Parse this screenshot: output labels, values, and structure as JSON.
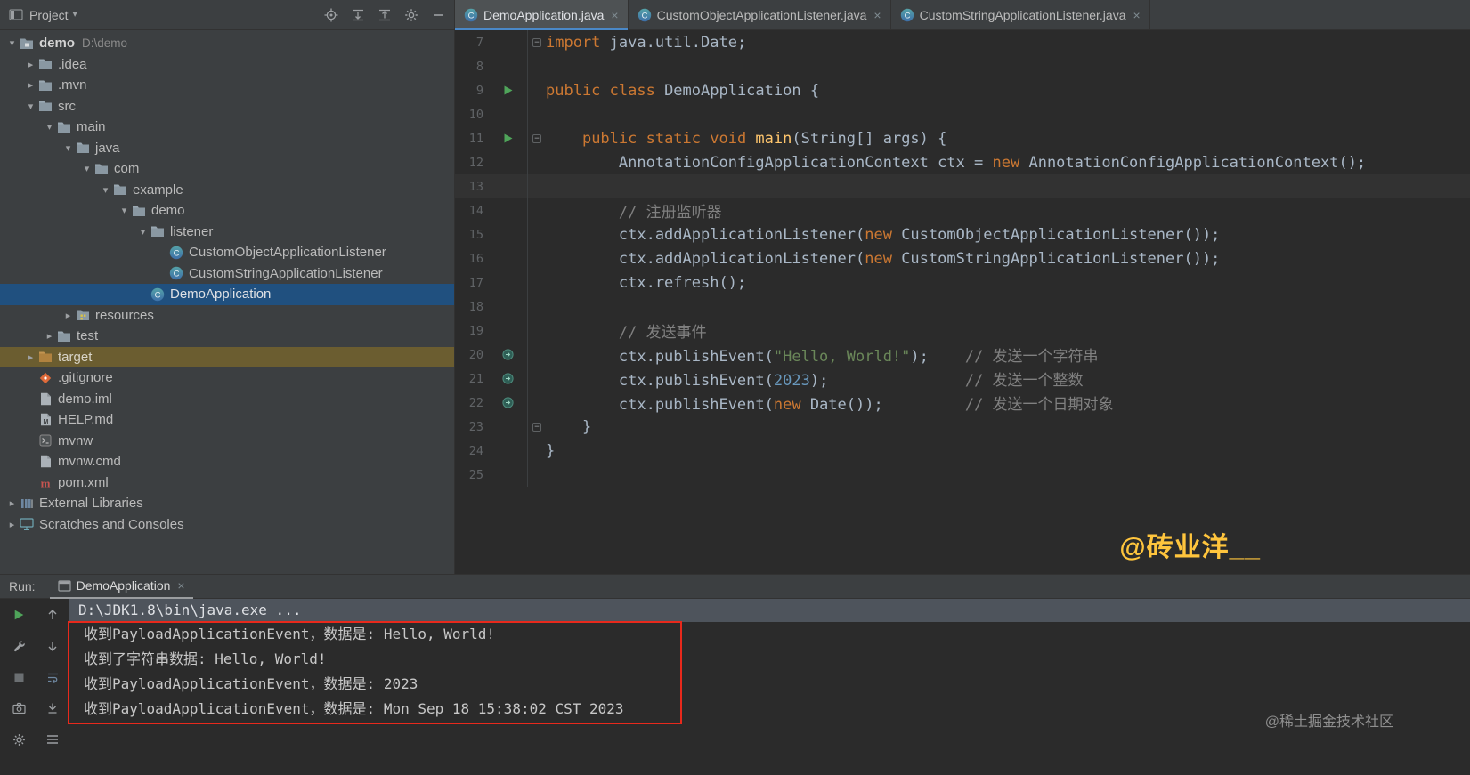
{
  "project_panel": {
    "header": {
      "title": "Project",
      "icons": [
        "locate",
        "expand",
        "collapse",
        "settings",
        "hide"
      ]
    },
    "tree": [
      {
        "label": "demo",
        "extra": "D:\\demo",
        "level": 0,
        "chevron": "down",
        "icon": "folder-project",
        "bold": true
      },
      {
        "label": ".idea",
        "level": 1,
        "chevron": "right",
        "icon": "folder"
      },
      {
        "label": ".mvn",
        "level": 1,
        "chevron": "right",
        "icon": "folder"
      },
      {
        "label": "src",
        "level": 1,
        "chevron": "down",
        "icon": "folder"
      },
      {
        "label": "main",
        "level": 2,
        "chevron": "down",
        "icon": "folder"
      },
      {
        "label": "java",
        "level": 3,
        "chevron": "down",
        "icon": "folder"
      },
      {
        "label": "com",
        "level": 4,
        "chevron": "down",
        "icon": "folder"
      },
      {
        "label": "example",
        "level": 5,
        "chevron": "down",
        "icon": "folder"
      },
      {
        "label": "demo",
        "level": 6,
        "chevron": "down",
        "icon": "folder"
      },
      {
        "label": "listener",
        "level": 7,
        "chevron": "down",
        "icon": "folder"
      },
      {
        "label": "CustomObjectApplicationListener",
        "level": 8,
        "chevron": "none",
        "icon": "class"
      },
      {
        "label": "CustomStringApplicationListener",
        "level": 8,
        "chevron": "none",
        "icon": "class"
      },
      {
        "label": "DemoApplication",
        "level": 7,
        "chevron": "none",
        "icon": "class",
        "selected": true
      },
      {
        "label": "resources",
        "level": 3,
        "chevron": "right",
        "icon": "folder-resources"
      },
      {
        "label": "test",
        "level": 2,
        "chevron": "right",
        "icon": "folder"
      },
      {
        "label": "target",
        "level": 1,
        "chevron": "right",
        "icon": "folder-excluded",
        "highlight": true
      },
      {
        "label": ".gitignore",
        "level": 1,
        "chevron": "none",
        "icon": "git"
      },
      {
        "label": "demo.iml",
        "level": 1,
        "chevron": "none",
        "icon": "file"
      },
      {
        "label": "HELP.md",
        "level": 1,
        "chevron": "none",
        "icon": "md"
      },
      {
        "label": "mvnw",
        "level": 1,
        "chevron": "none",
        "icon": "mvnw"
      },
      {
        "label": "mvnw.cmd",
        "level": 1,
        "chevron": "none",
        "icon": "file"
      },
      {
        "label": "pom.xml",
        "level": 1,
        "chevron": "none",
        "icon": "maven"
      },
      {
        "label": "External Libraries",
        "level": 0,
        "chevron": "right",
        "icon": "libraries"
      },
      {
        "label": "Scratches and Consoles",
        "level": 0,
        "chevron": "right",
        "icon": "scratches"
      }
    ]
  },
  "editor_tabs": [
    {
      "label": "DemoApplication.java",
      "active": true
    },
    {
      "label": "CustomObjectApplicationListener.java",
      "active": false
    },
    {
      "label": "CustomStringApplicationListener.java",
      "active": false
    }
  ],
  "editor": {
    "lines": [
      {
        "num": "7",
        "fold": true,
        "tokens": [
          {
            "t": "import ",
            "c": "kw"
          },
          {
            "t": "java.util.Date;",
            "c": "def"
          }
        ]
      },
      {
        "num": "8",
        "tokens": []
      },
      {
        "num": "9",
        "gutter": "run",
        "tokens": [
          {
            "t": "public class ",
            "c": "kw"
          },
          {
            "t": "DemoApplication {",
            "c": "def"
          }
        ]
      },
      {
        "num": "10",
        "tokens": []
      },
      {
        "num": "11",
        "gutter": "run",
        "fold": true,
        "tokens": [
          {
            "t": "    ",
            "c": "def"
          },
          {
            "t": "public static void ",
            "c": "kw"
          },
          {
            "t": "main",
            "c": "method"
          },
          {
            "t": "(String[] args) {",
            "c": "def"
          }
        ]
      },
      {
        "num": "12",
        "tokens": [
          {
            "t": "        AnnotationConfigApplicationContext ctx = ",
            "c": "def"
          },
          {
            "t": "new",
            "c": "kw"
          },
          {
            "t": " AnnotationConfigApplicationContext();",
            "c": "def"
          }
        ]
      },
      {
        "num": "13",
        "current": true,
        "tokens": []
      },
      {
        "num": "14",
        "tokens": [
          {
            "t": "        ",
            "c": "def"
          },
          {
            "t": "// 注册监听器",
            "c": "cm"
          }
        ]
      },
      {
        "num": "15",
        "tokens": [
          {
            "t": "        ctx.addApplicationListener(",
            "c": "def"
          },
          {
            "t": "new ",
            "c": "kw"
          },
          {
            "t": "CustomObjectApplicationListener());",
            "c": "def"
          }
        ]
      },
      {
        "num": "16",
        "tokens": [
          {
            "t": "        ctx.addApplicationListener(",
            "c": "def"
          },
          {
            "t": "new ",
            "c": "kw"
          },
          {
            "t": "CustomStringApplicationListener());",
            "c": "def"
          }
        ]
      },
      {
        "num": "17",
        "tokens": [
          {
            "t": "        ctx.refresh();",
            "c": "def"
          }
        ]
      },
      {
        "num": "18",
        "tokens": []
      },
      {
        "num": "19",
        "tokens": [
          {
            "t": "        ",
            "c": "def"
          },
          {
            "t": "// 发送事件",
            "c": "cm"
          }
        ]
      },
      {
        "num": "20",
        "gutter": "event",
        "tokens": [
          {
            "t": "        ctx.publishEvent(",
            "c": "def"
          },
          {
            "t": "\"Hello, World!\"",
            "c": "str"
          },
          {
            "t": ");    ",
            "c": "def"
          },
          {
            "t": "// 发送一个字符串",
            "c": "cm"
          }
        ]
      },
      {
        "num": "21",
        "gutter": "event",
        "tokens": [
          {
            "t": "        ctx.publishEvent(",
            "c": "def"
          },
          {
            "t": "2023",
            "c": "num"
          },
          {
            "t": ");               ",
            "c": "def"
          },
          {
            "t": "// 发送一个整数",
            "c": "cm"
          }
        ]
      },
      {
        "num": "22",
        "gutter": "event",
        "tokens": [
          {
            "t": "        ctx.publishEvent(",
            "c": "def"
          },
          {
            "t": "new ",
            "c": "kw"
          },
          {
            "t": "Date());         ",
            "c": "def"
          },
          {
            "t": "// 发送一个日期对象",
            "c": "cm"
          }
        ]
      },
      {
        "num": "23",
        "fold": true,
        "tokens": [
          {
            "t": "    }",
            "c": "def"
          }
        ]
      },
      {
        "num": "24",
        "tokens": [
          {
            "t": "}",
            "c": "def"
          }
        ]
      },
      {
        "num": "25",
        "tokens": []
      }
    ]
  },
  "watermark_editor": "@砖业洋__",
  "run_panel": {
    "label": "Run:",
    "tab": {
      "label": "DemoApplication"
    },
    "toolbar": [
      "rerun",
      "up",
      "wrench",
      "down",
      "stop",
      "softwrap",
      "camera",
      "scrollend",
      "gear",
      "menu"
    ],
    "command_line": "D:\\JDK1.8\\bin\\java.exe ...",
    "output": [
      "收到PayloadApplicationEvent，数据是: Hello, World!",
      "收到了字符串数据: Hello, World!",
      "收到PayloadApplicationEvent，数据是: 2023",
      "收到PayloadApplicationEvent，数据是: Mon Sep 18 15:38:02 CST 2023"
    ]
  },
  "watermark_corner": "@稀土掘金技术社区"
}
